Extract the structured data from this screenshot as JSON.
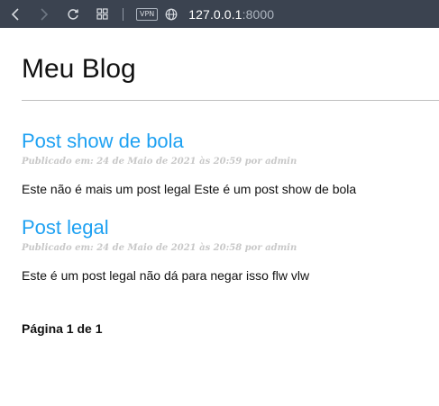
{
  "browser": {
    "vpn_label": "VPN",
    "url_host": "127.0.0.1",
    "url_port": ":8000"
  },
  "blog": {
    "title": "Meu Blog",
    "posts": [
      {
        "title": "Post show de bola",
        "meta": "Publicado em: 24 de Maio de 2021 às 20:59 por admin",
        "body": "Este não é mais um post legal Este é um post show de bola"
      },
      {
        "title": "Post legal",
        "meta": "Publicado em: 24 de Maio de 2021 às 20:58 por admin",
        "body": "Este é um post legal não dá para negar isso flw vlw"
      }
    ],
    "pagination": "Página 1 de 1"
  },
  "colors": {
    "browser_bar": "#3b4350",
    "link": "#1ea1f2",
    "meta": "#c8c8c8"
  }
}
